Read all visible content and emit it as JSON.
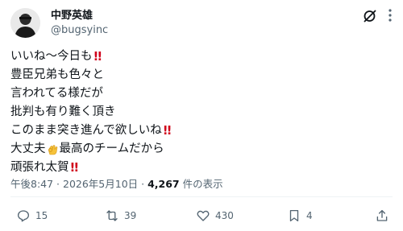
{
  "author": {
    "name": "中野英雄",
    "handle": "@bugsyinc"
  },
  "post": {
    "lines": [
      {
        "text": "いいね〜今日も",
        "suffix": "!!"
      },
      {
        "text": "豊臣兄弟も色々と",
        "suffix": ""
      },
      {
        "text": "言われてる様だが",
        "suffix": ""
      },
      {
        "text": "批判も有り難く頂き",
        "suffix": ""
      },
      {
        "text": "このまま突き進んで欲しいね",
        "suffix": "!!"
      },
      {
        "text": "大丈夫",
        "emoji": "ok-hand-emoji",
        "after": "最高のチームだから"
      },
      {
        "text": "頑張れ太賀",
        "suffix": "!!"
      }
    ]
  },
  "meta": {
    "time": "午後8:47",
    "sep1": " · ",
    "date": "2026年5月10日",
    "sep2": " · ",
    "views": "4,267",
    "views_label": " 件の表示"
  },
  "actions": {
    "replies": "15",
    "reposts": "39",
    "likes": "430",
    "bookmarks": "4"
  },
  "colors": {
    "text": "#0f1419",
    "muted": "#536471",
    "exclaim": "#d0021b"
  }
}
